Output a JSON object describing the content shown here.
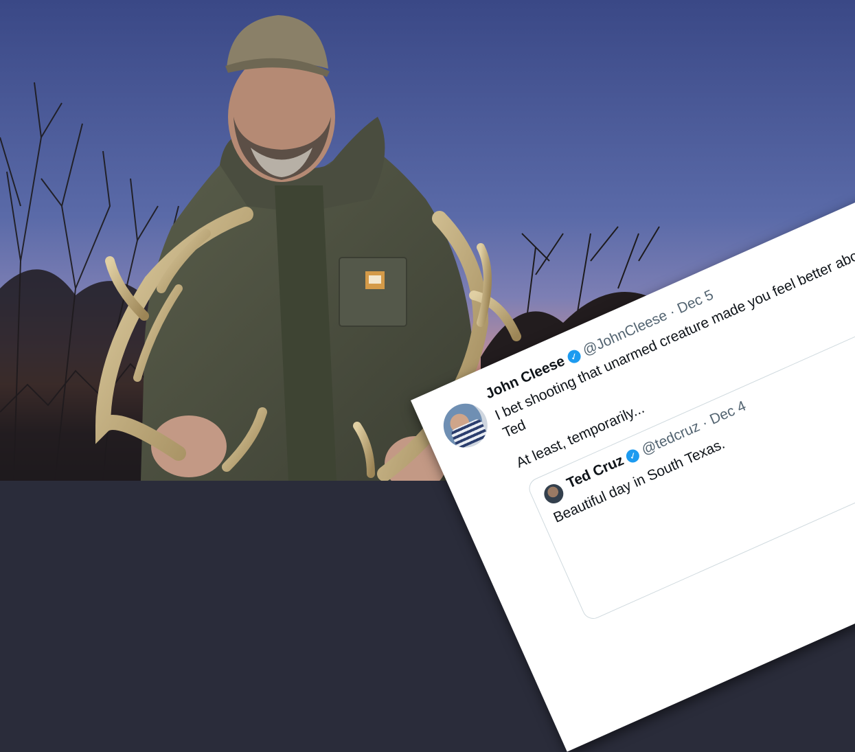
{
  "tweet": {
    "name": "John Cleese",
    "handle": "@JohnCleese",
    "separator": "·",
    "date": "Dec 5",
    "verified_glyph": "✓",
    "lines": [
      "I bet shooting that unarmed creature made you feel better about yo",
      "Ted",
      "At least, temporarily..."
    ]
  },
  "quoted_tweet": {
    "name": "Ted Cruz",
    "handle": "@tedcruz",
    "separator": "·",
    "date": "Dec 4",
    "verified_glyph": "✓",
    "text": "Beautiful day in South Texas."
  },
  "colors": {
    "sky_top": "#3b4a86",
    "sky_horizon": "#d98a6a",
    "jacket": "#4f5241",
    "antler": "#c8b48a",
    "verified": "#1d9bf0"
  },
  "icons": [
    "verified-badge-icon"
  ]
}
